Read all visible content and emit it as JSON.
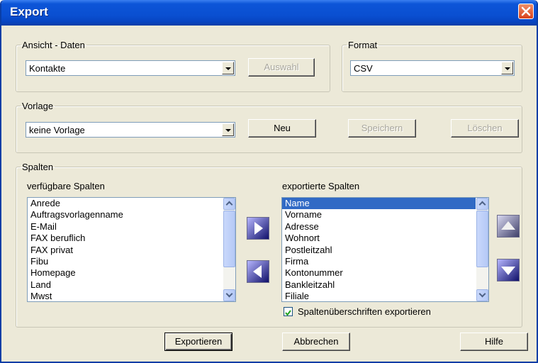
{
  "window": {
    "title": "Export"
  },
  "ansicht": {
    "legend": "Ansicht - Daten",
    "selected": "Kontakte",
    "auswahl_label": "Auswahl"
  },
  "format": {
    "legend": "Format",
    "selected": "CSV"
  },
  "vorlage": {
    "legend": "Vorlage",
    "selected": "keine Vorlage",
    "neu_label": "Neu",
    "speichern_label": "Speichern",
    "loeschen_label": "Löschen"
  },
  "spalten": {
    "legend": "Spalten",
    "available_label": "verfügbare Spalten",
    "available": [
      "Anrede",
      "Auftragsvorlagenname",
      "E-Mail",
      "FAX beruflich",
      "FAX privat",
      "Fibu",
      "Homepage",
      "Land",
      "Mwst"
    ],
    "exported_label": "exportierte Spalten",
    "exported": [
      "Name",
      "Vorname",
      "Adresse",
      "Wohnort",
      "Postleitzahl",
      "Firma",
      "Kontonummer",
      "Bankleitzahl",
      "Filiale"
    ],
    "exported_selected_index": 0,
    "headers_checkbox_label": "Spaltenüberschriften exportieren",
    "headers_checked": true
  },
  "footer": {
    "exportieren_label": "Exportieren",
    "abbrechen_label": "Abbrechen",
    "hilfe_label": "Hilfe"
  },
  "colors": {
    "titlebar": "#0a4fd1",
    "dialog_bg": "#ece9d8",
    "selection": "#316ac5",
    "close": "#d9411b"
  },
  "icons": [
    "close-icon",
    "dropdown-arrow-icon",
    "move-right-icon",
    "move-left-icon",
    "move-up-icon",
    "move-down-icon",
    "checkmark-icon"
  ]
}
